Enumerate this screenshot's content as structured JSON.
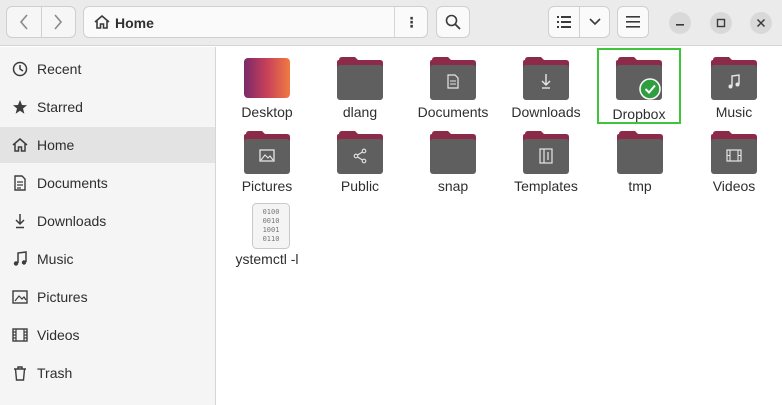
{
  "header": {
    "path_label": "Home",
    "nav_back_icon": "chevron-left-icon",
    "nav_forward_icon": "chevron-right-icon",
    "path_menu_glyph": "⋮"
  },
  "sidebar": {
    "items": [
      {
        "label": "Recent",
        "icon": "clock-icon"
      },
      {
        "label": "Starred",
        "icon": "star-icon"
      },
      {
        "label": "Home",
        "icon": "home-icon",
        "active": true
      },
      {
        "label": "Documents",
        "icon": "document-icon"
      },
      {
        "label": "Downloads",
        "icon": "download-icon"
      },
      {
        "label": "Music",
        "icon": "music-icon"
      },
      {
        "label": "Pictures",
        "icon": "image-icon"
      },
      {
        "label": "Videos",
        "icon": "film-icon"
      },
      {
        "label": "Trash",
        "icon": "trash-icon"
      }
    ]
  },
  "files": [
    {
      "label": "Desktop",
      "icon": "desktop-folder-icon"
    },
    {
      "label": "dlang",
      "icon": "folder-icon"
    },
    {
      "label": "Documents",
      "icon": "documents-folder-icon"
    },
    {
      "label": "Downloads",
      "icon": "downloads-folder-icon"
    },
    {
      "label": "Dropbox",
      "icon": "dropbox-folder-icon",
      "selected": true
    },
    {
      "label": "Music",
      "icon": "music-folder-icon"
    },
    {
      "label": "Pictures",
      "icon": "pictures-folder-icon"
    },
    {
      "label": "Public",
      "icon": "public-folder-icon"
    },
    {
      "label": "snap",
      "icon": "folder-icon"
    },
    {
      "label": "Templates",
      "icon": "templates-folder-icon"
    },
    {
      "label": "tmp",
      "icon": "folder-icon"
    },
    {
      "label": "Videos",
      "icon": "videos-folder-icon"
    },
    {
      "label": "ystemctl -l",
      "icon": "binary-file-icon"
    }
  ],
  "colors": {
    "folder_tab": "#8c2a4a",
    "folder_body": "#5f5f5f",
    "selection": "#3fc53a",
    "sync_badge": "#2e9e3e"
  }
}
